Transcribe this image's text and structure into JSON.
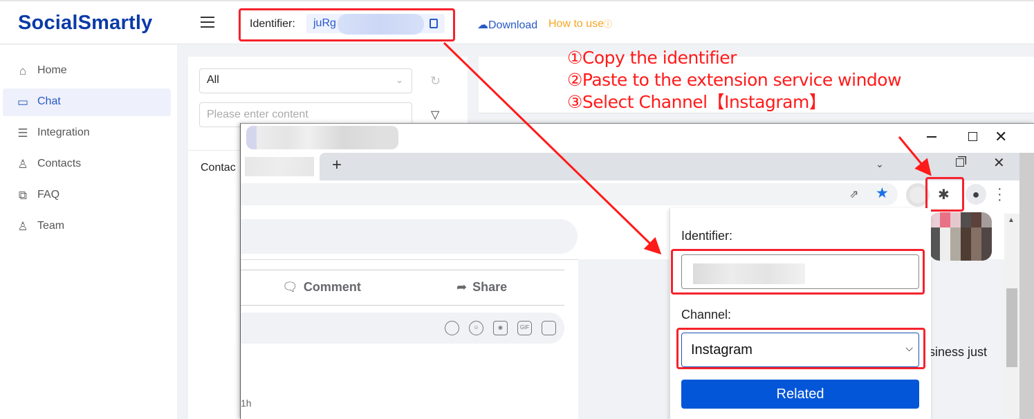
{
  "app": {
    "logo": "SocialSmartly"
  },
  "header": {
    "identifier_label": "Identifier:",
    "identifier_value": "juRg",
    "download_label": "Download",
    "how_to_use_label": "How to use"
  },
  "sidebar": {
    "items": [
      {
        "label": "Home",
        "icon": "home-icon"
      },
      {
        "label": "Chat",
        "icon": "chat-icon",
        "active": true
      },
      {
        "label": "Integration",
        "icon": "list-icon"
      },
      {
        "label": "Contacts",
        "icon": "user-icon"
      },
      {
        "label": "FAQ",
        "icon": "faq-icon"
      },
      {
        "label": "Team",
        "icon": "team-icon"
      }
    ]
  },
  "chat_panel": {
    "filter_select": "All",
    "search_placeholder": "Please enter content",
    "contacts_tab": "Contac"
  },
  "instructions": [
    "①Copy the identifier",
    "②Paste to the extension service window",
    "③Select Channel【Instagram】"
  ],
  "browser": {
    "page": {
      "comment_label": "Comment",
      "share_label": "Share",
      "time_ago": "1h",
      "post_text_fragment": "siness just",
      "comment_icons": [
        "avatar-sticker-icon",
        "emoji-icon",
        "camera-icon",
        "gif-icon",
        "sticker-icon"
      ]
    },
    "extension_popup": {
      "identifier_label": "Identifier:",
      "identifier_value": "",
      "channel_label": "Channel:",
      "channel_selected": "Instagram",
      "submit_label": "Related"
    }
  },
  "colors": {
    "brand": "#0b3aa8",
    "link": "#2859c5",
    "how_to": "#f5a623",
    "annotation": "#ff1a1a",
    "primary_button": "#0356d8"
  }
}
